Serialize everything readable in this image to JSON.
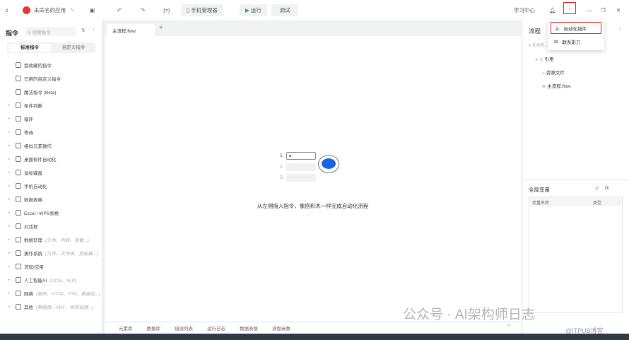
{
  "topbar": {
    "app_name": "未命名的应用",
    "phone_manager": "手机管理器",
    "run": "运行",
    "debug": "调试",
    "learn": "学习中心"
  },
  "menu": {
    "items": [
      "自动化插件",
      "联系影刀"
    ]
  },
  "left": {
    "title": "指令",
    "search_placeholder": "搜索指令",
    "tabs": [
      "标准指令",
      "自定义指令"
    ],
    "items": [
      {
        "label": "我收藏的指令",
        "hint": "",
        "arrow": false
      },
      {
        "label": "已用的自定义指令",
        "hint": "",
        "arrow": false
      },
      {
        "label": "魔法指令 (Beta)",
        "hint": "",
        "arrow": false
      },
      {
        "label": "条件判断",
        "hint": "",
        "arrow": true
      },
      {
        "label": "循环",
        "hint": "",
        "arrow": true
      },
      {
        "label": "等待",
        "hint": "",
        "arrow": true
      },
      {
        "label": "相似元素操作",
        "hint": "",
        "arrow": true
      },
      {
        "label": "桌面软件自动化",
        "hint": "",
        "arrow": true
      },
      {
        "label": "鼠标键盘",
        "hint": "",
        "arrow": true
      },
      {
        "label": "手机自动化",
        "hint": "",
        "arrow": true
      },
      {
        "label": "数据表格",
        "hint": "",
        "arrow": true
      },
      {
        "label": "Excel / WPS表格",
        "hint": "",
        "arrow": true
      },
      {
        "label": "对话框",
        "hint": "",
        "arrow": true
      },
      {
        "label": "数据处理",
        "hint": "(文本、列表、变量...)",
        "arrow": true
      },
      {
        "label": "操作系统",
        "hint": "(文件、文件夹、剪贴板...)",
        "arrow": true
      },
      {
        "label": "流程/应用",
        "hint": "",
        "arrow": true
      },
      {
        "label": "人工智能AI",
        "hint": "(OCR、NLP)",
        "arrow": true
      },
      {
        "label": "网络",
        "hint": "(邮件、HTTP、FTP、数据处...)",
        "arrow": true
      },
      {
        "label": "其他",
        "hint": "(数据库、PDF、异常处理...)",
        "arrow": true
      }
    ]
  },
  "editor": {
    "tab": "主流程.flow",
    "rows": [
      "1",
      "2",
      "3"
    ],
    "empty_text": "从左侧拖入指令，像搭积木一样完成自动化流程"
  },
  "bottom_tabs": [
    "元素库",
    "图像库",
    "错误列表",
    "运行日志",
    "数据表格",
    "流程参数"
  ],
  "right": {
    "title": "流程",
    "tree": [
      "未命名...",
      "引用",
      "资源文件",
      "主流程.flow"
    ],
    "vars_title": "全局变量",
    "var_cols": [
      "变量名称",
      "类型"
    ]
  },
  "watermark": {
    "main": "公众号 · AI架构师日志",
    "sub": "@ITPUB博客"
  }
}
